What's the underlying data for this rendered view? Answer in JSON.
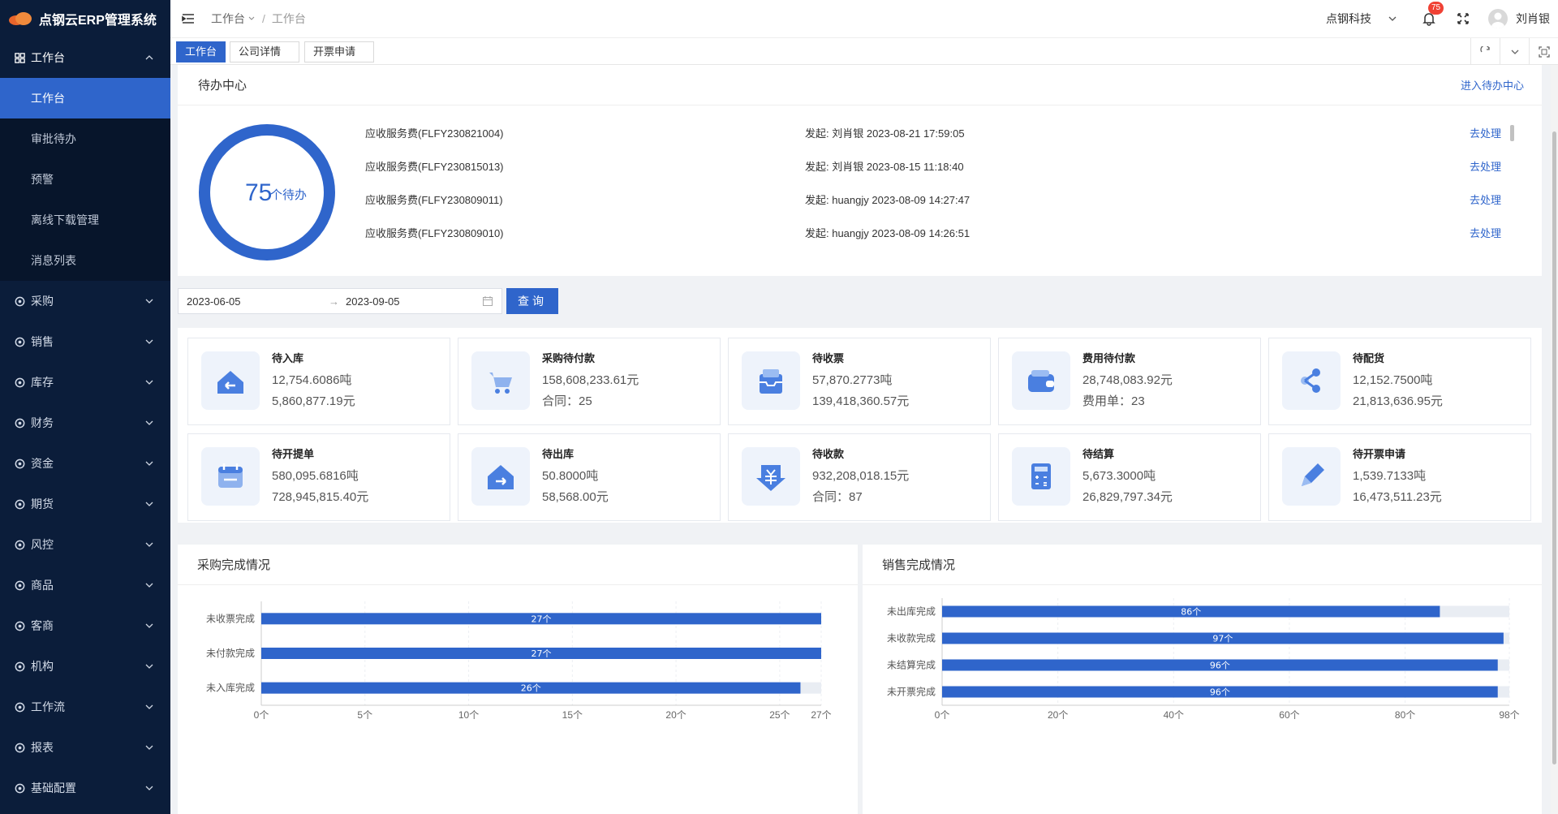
{
  "app": {
    "title": "点钢云ERP管理系统"
  },
  "sidebar": {
    "items": [
      {
        "label": "工作台",
        "icon": "grid-icon",
        "open": true,
        "children": [
          {
            "label": "工作台",
            "active": true
          },
          {
            "label": "审批待办"
          },
          {
            "label": "预警"
          },
          {
            "label": "离线下载管理"
          },
          {
            "label": "消息列表"
          }
        ]
      },
      {
        "label": "采购",
        "icon": "purchase-icon"
      },
      {
        "label": "销售",
        "icon": "sales-icon"
      },
      {
        "label": "库存",
        "icon": "warehouse-icon"
      },
      {
        "label": "财务",
        "icon": "finance-icon"
      },
      {
        "label": "资金",
        "icon": "fund-icon"
      },
      {
        "label": "期货",
        "icon": "futures-icon"
      },
      {
        "label": "风控",
        "icon": "shield-icon"
      },
      {
        "label": "商品",
        "icon": "goods-icon"
      },
      {
        "label": "客商",
        "icon": "customer-icon"
      },
      {
        "label": "机构",
        "icon": "organization-icon"
      },
      {
        "label": "工作流",
        "icon": "workflow-icon"
      },
      {
        "label": "报表",
        "icon": "report-icon"
      },
      {
        "label": "基础配置",
        "icon": "gear-icon"
      }
    ]
  },
  "header": {
    "breadcrumb": [
      "工作台",
      "工作台"
    ],
    "company": "点钢科技",
    "notification_count": "75",
    "user": "刘肖银"
  },
  "tabs": [
    "工作台",
    "公司详情",
    "开票申请"
  ],
  "todo": {
    "title": "待办中心",
    "enter_link": "进入待办中心",
    "count": "75",
    "count_unit": "个待办",
    "items": [
      {
        "name": "应收服务费(FLFY230821004)",
        "initiator": "发起: 刘肖银 2023-08-21 17:59:05",
        "action": "去处理"
      },
      {
        "name": "应收服务费(FLFY230815013)",
        "initiator": "发起: 刘肖银 2023-08-15 11:18:40",
        "action": "去处理"
      },
      {
        "name": "应收服务费(FLFY230809011)",
        "initiator": "发起: huangjy 2023-08-09 14:27:47",
        "action": "去处理"
      },
      {
        "name": "应收服务费(FLFY230809010)",
        "initiator": "发起: huangjy 2023-08-09 14:26:51",
        "action": "去处理"
      }
    ]
  },
  "filter": {
    "start_date": "2023-06-05",
    "end_date": "2023-09-05",
    "query_button": "查询"
  },
  "stats": [
    {
      "title": "待入库",
      "v1": "12,754.6086吨",
      "v2": "5,860,877.19元",
      "icon": "house-in-icon"
    },
    {
      "title": "采购待付款",
      "v1": "158,608,233.61元",
      "v2": "合同：25",
      "icon": "cart-icon"
    },
    {
      "title": "待收票",
      "v1": "57,870.2773吨",
      "v2": "139,418,360.57元",
      "icon": "inbox-icon"
    },
    {
      "title": "费用待付款",
      "v1": "28,748,083.92元",
      "v2": "费用单：23",
      "icon": "wallet-icon"
    },
    {
      "title": "待配货",
      "v1": "12,152.7500吨",
      "v2": "21,813,636.95元",
      "icon": "share-icon"
    },
    {
      "title": "待开提单",
      "v1": "580,095.6816吨",
      "v2": "728,945,815.40元",
      "icon": "calendar-icon"
    },
    {
      "title": "待出库",
      "v1": "50.8000吨",
      "v2": "58,568.00元",
      "icon": "house-out-icon"
    },
    {
      "title": "待收款",
      "v1": "932,208,018.15元",
      "v2": "合同：87",
      "icon": "yuan-down-icon"
    },
    {
      "title": "待结算",
      "v1": "5,673.3000吨",
      "v2": "26,829,797.34元",
      "icon": "calculator-icon"
    },
    {
      "title": "待开票申请",
      "v1": "1,539.7133吨",
      "v2": "16,473,511.23元",
      "icon": "pencil-icon"
    }
  ],
  "colors": {
    "primary": "#2f65cb",
    "sidebar_bg": "#0b1d3a",
    "bar_bg": "#e9edf3"
  },
  "chart_data": [
    {
      "type": "bar",
      "title": "采购完成情况",
      "orientation": "horizontal",
      "categories": [
        "未收票完成",
        "未付款完成",
        "未入库完成"
      ],
      "values": [
        27,
        27,
        26
      ],
      "totals": [
        27,
        27,
        27
      ],
      "value_labels": [
        "27个",
        "27个",
        "26个"
      ],
      "x_ticks": [
        "0个",
        "5个",
        "10个",
        "15个",
        "20个",
        "25个",
        "27个"
      ],
      "xlim": [
        0,
        27
      ],
      "grid": true
    },
    {
      "type": "bar",
      "title": "销售完成情况",
      "orientation": "horizontal",
      "categories": [
        "未出库完成",
        "未收款完成",
        "未结算完成",
        "未开票完成"
      ],
      "values": [
        86,
        97,
        96,
        96
      ],
      "totals": [
        98,
        98,
        98,
        98
      ],
      "value_labels": [
        "86个",
        "97个",
        "96个",
        "96个"
      ],
      "x_ticks": [
        "0个",
        "20个",
        "40个",
        "60个",
        "80个",
        "98个"
      ],
      "xlim": [
        0,
        98
      ],
      "grid": true
    }
  ]
}
